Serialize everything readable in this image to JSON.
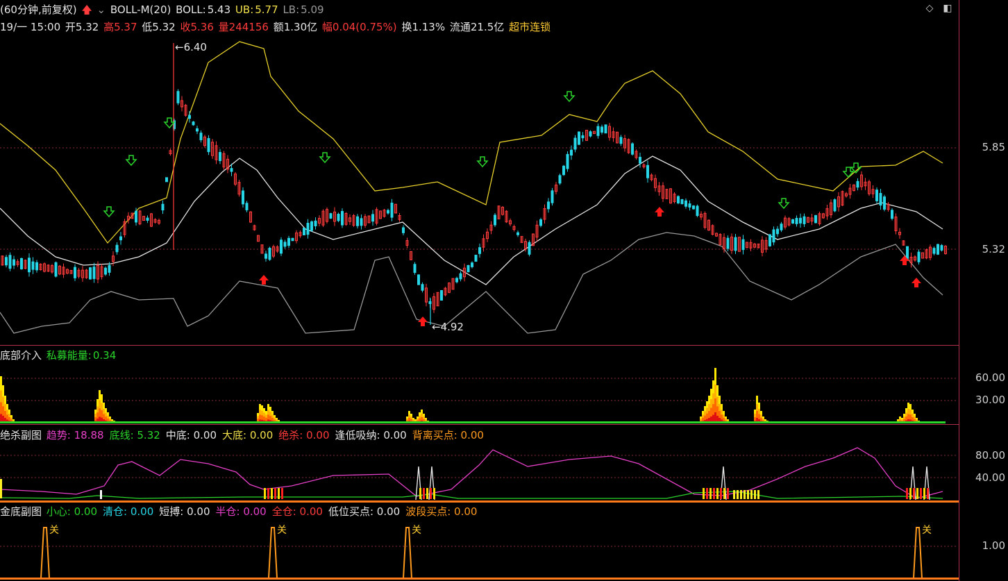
{
  "header": {
    "period": "(60分钟,前复权)",
    "indicator": "BOLL-M(20)",
    "boll_label": "BOLL:",
    "boll": "5.43",
    "ub_label": "UB:",
    "ub": "5.77",
    "lb_label": "LB:",
    "lb": "5.09"
  },
  "quote": {
    "datetime": "19/一 15:00",
    "open": "开5.32",
    "high": "高5.37",
    "low": "低5.32",
    "close": "收5.36",
    "volume": "量244156",
    "amount": "额1.30亿",
    "change": "幅0.04(0.75%)",
    "turnover": "换1.13%",
    "float": "流通21.5亿",
    "sector": "超市连锁"
  },
  "main_chart": {
    "high_marker": "6.40",
    "low_marker": "4.92",
    "axis_labels": [
      "5.85",
      "5.32"
    ]
  },
  "panel1": {
    "name": "底部介入",
    "item_label": "私募能量:",
    "item_value": "0.34",
    "axis_labels": [
      "60.00",
      "30.00"
    ]
  },
  "panel2": {
    "name": "绝杀副图",
    "items": [
      {
        "label": "趋势:",
        "value": "18.88",
        "color": "#e640c8"
      },
      {
        "label": "底线:",
        "value": "5.32",
        "color": "#2bd62b"
      },
      {
        "label": "中底:",
        "value": "0.00",
        "color": "#e6e6e6"
      },
      {
        "label": "大底:",
        "value": "0.00",
        "color": "#f2e04a"
      },
      {
        "label": "绝杀:",
        "value": "0.00",
        "color": "#ff3b3b"
      },
      {
        "label": "逢低吸纳:",
        "value": "0.00",
        "color": "#e6e6e6"
      },
      {
        "label": "背离买点:",
        "value": "0.00",
        "color": "#ff9a1e"
      }
    ],
    "axis_labels": [
      "80.00",
      "40.00"
    ]
  },
  "panel3": {
    "name": "金底副图",
    "items": [
      {
        "label": "小心:",
        "value": "0.00",
        "color": "#2bd62b"
      },
      {
        "label": "清仓:",
        "value": "0.00",
        "color": "#27d6e6"
      },
      {
        "label": "短搏:",
        "value": "0.00",
        "color": "#e6e6e6"
      },
      {
        "label": "半仓:",
        "value": "0.00",
        "color": "#e640c8"
      },
      {
        "label": "全仓:",
        "value": "0.00",
        "color": "#ff3b3b"
      },
      {
        "label": "低位买点:",
        "value": "0.00",
        "color": "#e6e6e6"
      },
      {
        "label": "波段买点:",
        "value": "0.00",
        "color": "#ff9a1e"
      }
    ],
    "signal_label": "关",
    "axis_labels": [
      "1.00"
    ]
  },
  "colors": {
    "up": "#ff3b3b",
    "down": "#27d6e6",
    "mid_band": "#e6e6e6",
    "upper_band": "#e8d22a",
    "lower_band": "#9a9a9a"
  }
}
